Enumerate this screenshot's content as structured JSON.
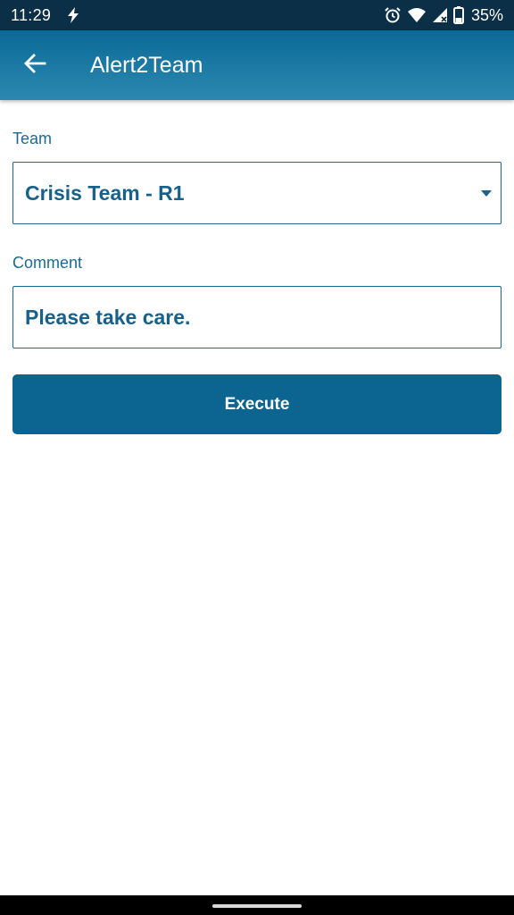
{
  "status_bar": {
    "time": "11:29",
    "battery_text": "35%",
    "icons": [
      "flash-icon",
      "alarm-icon",
      "wifi-icon",
      "signal-icon",
      "battery-icon"
    ]
  },
  "app_bar": {
    "title": "Alert2Team",
    "back_icon": "arrow-left-icon"
  },
  "form": {
    "team_label": "Team",
    "team_value": "Crisis Team - R1",
    "comment_label": "Comment",
    "comment_value": "Please take care.",
    "execute_label": "Execute"
  },
  "colors": {
    "status_bar_bg": "#0b2f47",
    "app_bar_start": "#0a6a96",
    "app_bar_end": "#2c88b0",
    "accent": "#17618a",
    "button_bg": "#0b6590"
  }
}
